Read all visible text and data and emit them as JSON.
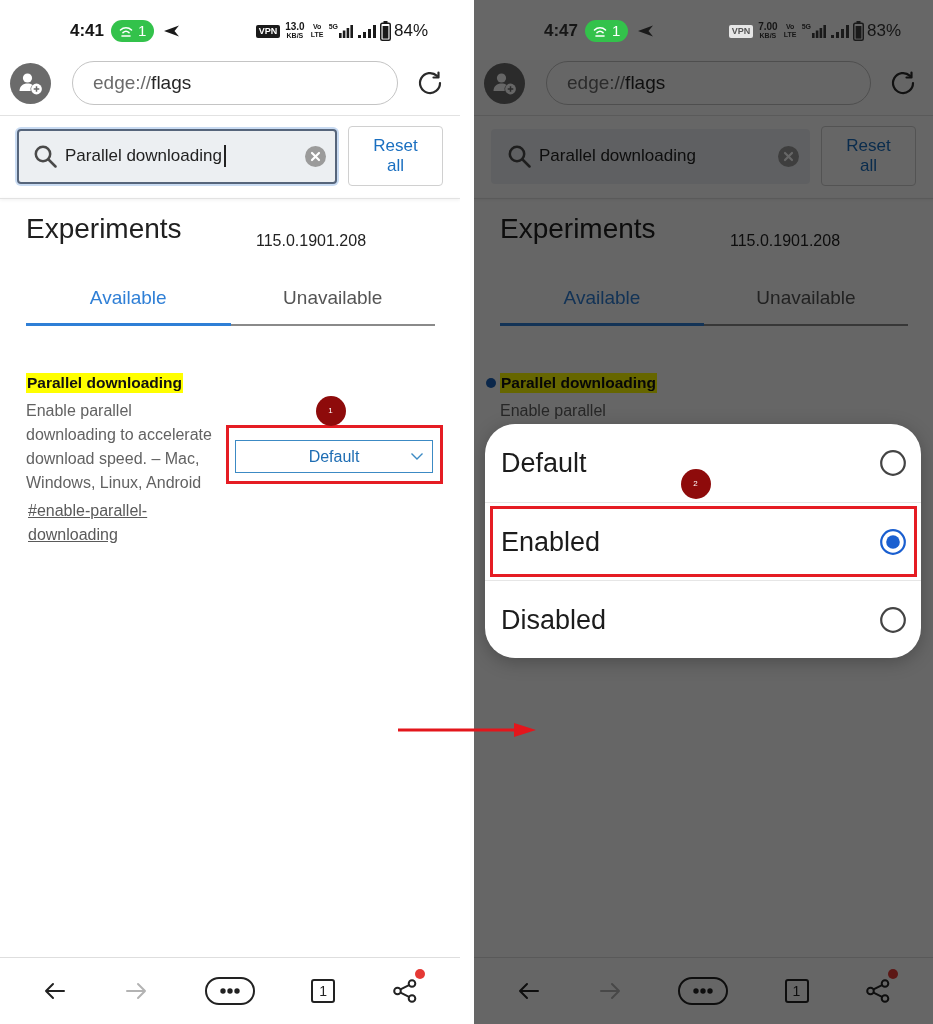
{
  "screens": [
    {
      "dimmed": false,
      "status_bar": {
        "time": "4:41",
        "hotspot_count": "1",
        "vpn": "VPN",
        "speed": "13.0",
        "speed_unit": "KB/S",
        "volte": "Vo LTE",
        "network": "5G",
        "battery": "84%"
      },
      "address_bar": {
        "scheme": "edge://",
        "host": "flags"
      },
      "search": {
        "value": "Parallel downloading",
        "focused": true
      },
      "reset_button": "Reset all",
      "heading": "Experiments",
      "version": "115.0.1901.208",
      "tabs": [
        {
          "label": "Available",
          "selected": true
        },
        {
          "label": "Unavailable",
          "selected": false
        }
      ],
      "flag": {
        "title": "Parallel downloading",
        "modified": false,
        "description": "Enable parallel downloading to accelerate download speed. – Mac, Windows, Linux, Android",
        "link": "#enable-parallel-downloading",
        "select": {
          "value": "Default",
          "annotated": true,
          "marker": "1"
        }
      },
      "nav": [
        {
          "kind": "back",
          "disabled": false
        },
        {
          "kind": "forward",
          "disabled": true
        },
        {
          "kind": "more",
          "disabled": false
        },
        {
          "kind": "tabs",
          "count": "1",
          "disabled": false
        },
        {
          "kind": "share",
          "badge": true,
          "disabled": false
        }
      ]
    },
    {
      "dimmed": true,
      "status_bar": {
        "time": "4:47",
        "hotspot_count": "1",
        "vpn": "VPN",
        "speed": "7.00",
        "speed_unit": "KB/S",
        "volte": "Vo LTE",
        "network": "5G",
        "battery": "83%"
      },
      "address_bar": {
        "scheme": "edge://",
        "host": "flags"
      },
      "search": {
        "value": "Parallel downloading",
        "focused": false
      },
      "reset_button": "Reset all",
      "heading": "Experiments",
      "version": "115.0.1901.208",
      "tabs": [
        {
          "label": "Available",
          "selected": true
        },
        {
          "label": "Unavailable",
          "selected": false
        }
      ],
      "flag": {
        "title": "Parallel downloading",
        "modified": true,
        "description": "Enable parallel"
      },
      "dialog": {
        "options": [
          {
            "label": "Default",
            "selected": false,
            "annotated": false
          },
          {
            "label": "Enabled",
            "selected": true,
            "annotated": true,
            "marker": "2"
          },
          {
            "label": "Disabled",
            "selected": false,
            "annotated": false
          }
        ]
      },
      "nav": [
        {
          "kind": "back",
          "disabled": false
        },
        {
          "kind": "forward",
          "disabled": true
        },
        {
          "kind": "more",
          "disabled": false
        },
        {
          "kind": "tabs",
          "count": "1",
          "disabled": false
        },
        {
          "kind": "share",
          "badge": true,
          "disabled": false
        }
      ]
    }
  ]
}
